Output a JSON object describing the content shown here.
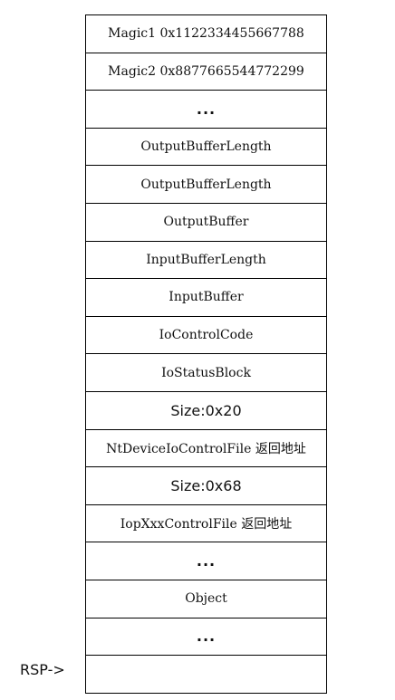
{
  "stack": {
    "cells": [
      {
        "text": "Magic1 0x1122334455667788",
        "style": "mono"
      },
      {
        "text": "Magic2 0x8877665544772299",
        "style": "mono"
      },
      {
        "text": "...",
        "style": "ellipsis"
      },
      {
        "text": "OutputBufferLength",
        "style": "mono"
      },
      {
        "text": "OutputBufferLength",
        "style": "mono"
      },
      {
        "text": "OutputBuffer",
        "style": "mono"
      },
      {
        "text": "InputBufferLength",
        "style": "mono"
      },
      {
        "text": "InputBuffer",
        "style": "mono"
      },
      {
        "text": "IoControlCode",
        "style": "mono"
      },
      {
        "text": "IoStatusBlock",
        "style": "mono"
      },
      {
        "text": "Size:0x20",
        "style": "sans"
      },
      {
        "text": "NtDeviceIoControlFile 返回地址",
        "style": "mono"
      },
      {
        "text": "Size:0x68",
        "style": "sans"
      },
      {
        "text": "IopXxxControlFile 返回地址",
        "style": "mono"
      },
      {
        "text": "...",
        "style": "ellipsis"
      },
      {
        "text": "Object",
        "style": "mono"
      },
      {
        "text": "...",
        "style": "ellipsis"
      },
      {
        "text": "",
        "style": "mono"
      }
    ]
  },
  "rsp_label": "RSP->",
  "colors": {
    "border": "#000000",
    "text": "#111111",
    "background": "#ffffff"
  }
}
